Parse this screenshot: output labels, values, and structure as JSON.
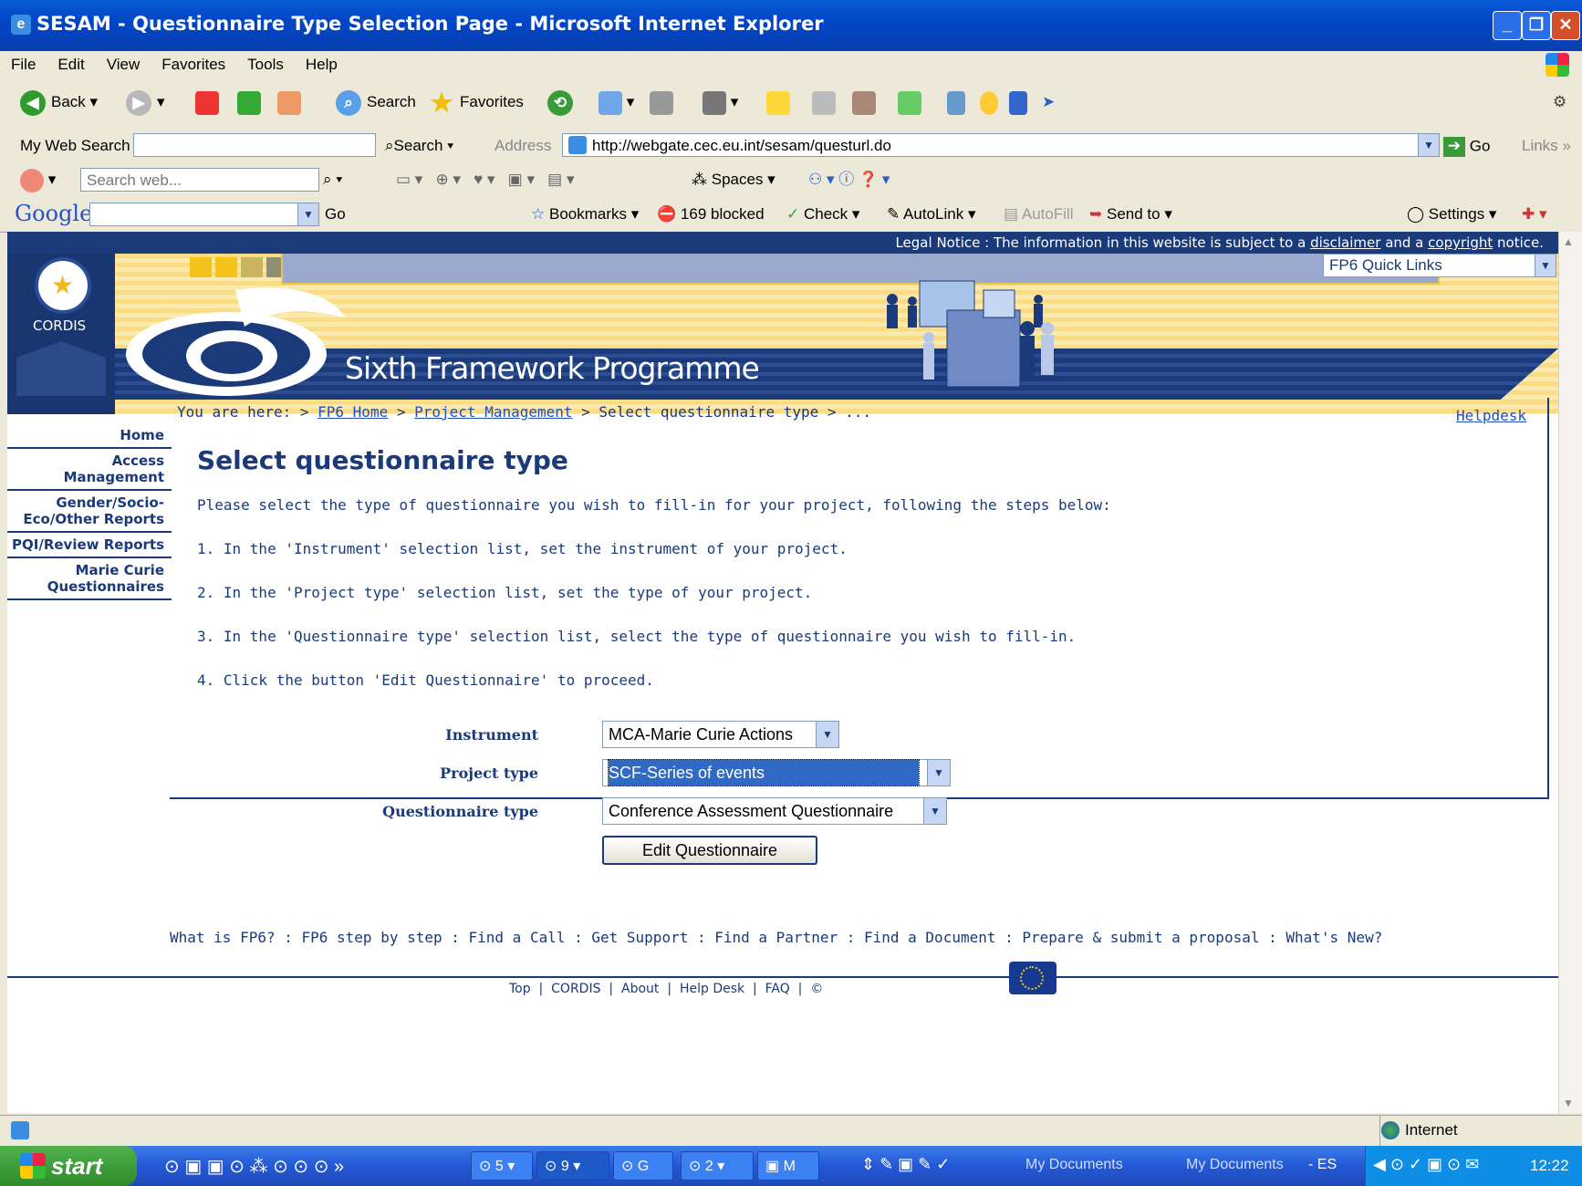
{
  "window": {
    "title": "SESAM - Questionnaire Type Selection Page - Microsoft Internet Explorer"
  },
  "menu": [
    "File",
    "Edit",
    "View",
    "Favorites",
    "Tools",
    "Help"
  ],
  "toolbar": {
    "back": "Back",
    "search": "Search",
    "favorites": "Favorites"
  },
  "address": {
    "my_web_search_label": "My Web Search",
    "search_btn": "Search",
    "label": "Address",
    "url": "http://webgate.cec.eu.int/sesam/questurl.do",
    "go": "Go",
    "links": "Links"
  },
  "yahoo": {
    "placeholder": "Search web...",
    "spaces": "Spaces"
  },
  "google": {
    "logo": "Google",
    "go": "Go",
    "bookmarks": "Bookmarks",
    "blocked": "169 blocked",
    "check": "Check",
    "autolink": "AutoLink",
    "autofill": "AutoFill",
    "sendto": "Send to",
    "settings": "Settings"
  },
  "site": {
    "legal_prefix": "Legal Notice : The information in this website is subject to a",
    "disclaimer": "disclaimer",
    "and_a": "and a",
    "copyright": "copyright",
    "notice": "notice.",
    "cordis": "CORDIS",
    "programme": "Sixth Framework Programme",
    "quick_links": "FP6 Quick Links"
  },
  "sidebar": [
    "Home",
    "Access Management",
    "Gender/Socio-Eco/Other Reports",
    "PQI/Review Reports",
    "Marie Curie Questionnaires"
  ],
  "breadcrumb": {
    "prefix": "You are here: >",
    "fp6_home": "FP6 Home",
    "sep": ">",
    "project_management": "Project Management",
    "current": "> Select questionnaire type > ..."
  },
  "helpdesk": "Helpdesk",
  "main": {
    "heading": "Select questionnaire type",
    "intro": "Please select the type of questionnaire you wish to fill-in for your project, following the steps below:",
    "step1": "1. In the 'Instrument' selection list, set the instrument of your project.",
    "step2": "2. In the 'Project type' selection list, set the type of your project.",
    "step3": "3. In the 'Questionnaire type' selection list, select the type of questionnaire you wish to fill-in.",
    "step4": "4. Click the button 'Edit Questionnaire' to proceed."
  },
  "form": {
    "instrument_label": "Instrument",
    "instrument_value": "MCA-Marie Curie Actions",
    "project_type_label": "Project type",
    "project_type_value": "SCF-Series of events",
    "questionnaire_type_label": "Questionnaire type",
    "questionnaire_type_value": "Conference Assessment Questionnaire",
    "edit_button": "Edit Questionnaire"
  },
  "footer_links": "What is FP6? : FP6 step by step : Find a Call : Get Support : Find a Partner : Find a Document : Prepare & submit a proposal : What's New?",
  "footer_nav": [
    "Top",
    "CORDIS",
    "About",
    "Help Desk",
    "FAQ",
    "©"
  ],
  "status": {
    "zone": "Internet"
  },
  "taskbar": {
    "start": "start",
    "tasks": [
      "5",
      "9",
      "G",
      "2",
      "M"
    ],
    "mydocs1": "My Documents",
    "mydocs2": "My Documents",
    "es": "- ES",
    "clock": "12:22"
  },
  "colors": {
    "navy": "#1b3a7a",
    "link": "#1f4fbf",
    "xp_blue": "#0046c7",
    "start_green": "#2e8b2a"
  }
}
